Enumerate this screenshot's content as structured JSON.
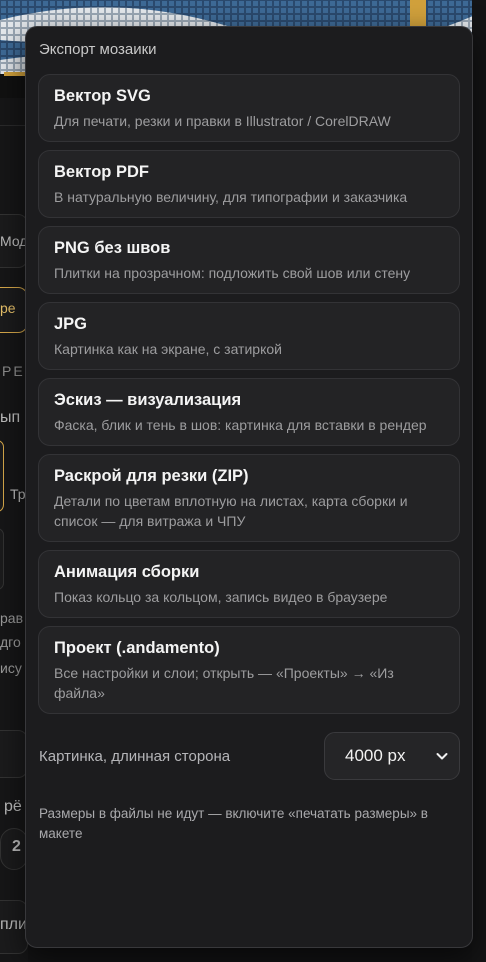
{
  "background": {
    "fragments": [
      "Мод",
      "ре",
      "РЕ",
      "ып",
      "Тр",
      "рав",
      "дго",
      "ису",
      "рё",
      "2",
      "пли"
    ]
  },
  "menu": {
    "title": "Экспорт мозаики",
    "options": [
      {
        "title": "Вектор SVG",
        "desc": "Для печати, резки и правки в Illustrator / CorelDRAW"
      },
      {
        "title": "Вектор PDF",
        "desc": "В натуральную величину, для типографии и заказчика"
      },
      {
        "title": "PNG без швов",
        "desc": "Плитки на прозрачном: подложить свой шов или стену"
      },
      {
        "title": "JPG",
        "desc": "Картинка как на экране, с затиркой"
      },
      {
        "title": "Эскиз — визуализация",
        "desc": "Фаска, блик и тень в шов: картинка для вставки в рендер"
      },
      {
        "title": "Раскрой для резки (ZIP)",
        "desc": "Детали по цветам вплотную на листах, карта сборки и список — для витража и ЧПУ"
      },
      {
        "title": "Анимация сборки",
        "desc": "Показ кольцо за кольцом, запись видео в браузере"
      },
      {
        "title": "Проект (.andamento)",
        "desc": "Все настройки и слои; открыть — «Проекты» → «Из файла»"
      }
    ],
    "size_label": "Картинка, длинная сторона",
    "size_value": "4000 px",
    "hint": "Размеры в файлы не идут — включите «печатать размеры» в макете"
  },
  "colors": {
    "panel_bg": "#1c1c1e",
    "option_bg": "#232325",
    "accent_gold": "#e8c26a"
  }
}
